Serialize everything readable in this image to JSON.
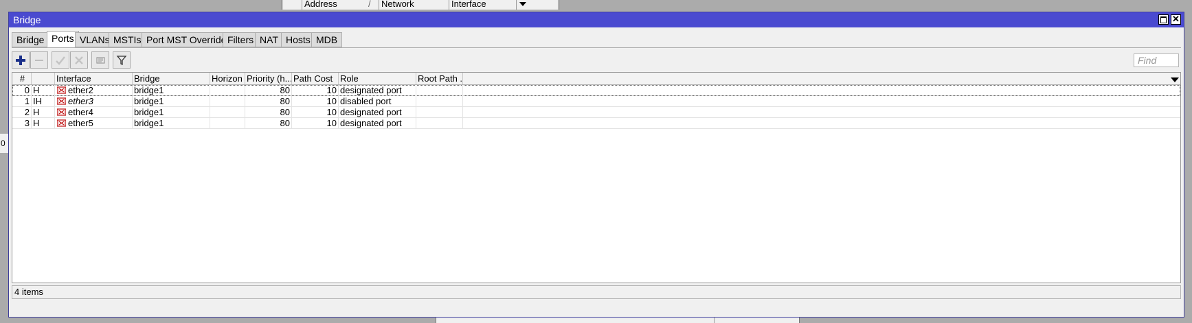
{
  "background_window": {
    "columns": [
      "Address",
      "Network",
      "Interface"
    ],
    "sort_mark": "/",
    "left_fragment": "0"
  },
  "window": {
    "title": "Bridge"
  },
  "tabs": [
    "Bridge",
    "Ports",
    "VLANs",
    "MSTIs",
    "Port MST Overrides",
    "Filters",
    "NAT",
    "Hosts",
    "MDB"
  ],
  "active_tab": "Ports",
  "toolbar": {
    "find_placeholder": "Find",
    "find_value": ""
  },
  "table": {
    "columns": [
      "#",
      "",
      "Interface",
      "Bridge",
      "Horizon",
      "Priority (h...",
      "Path Cost",
      "Role",
      "Root Path ..."
    ],
    "rows": [
      {
        "num": "0",
        "flags": "H",
        "interface": "ether2",
        "bridge": "bridge1",
        "horizon": "",
        "priority": "80",
        "path_cost": "10",
        "role": "designated port",
        "root_path": ""
      },
      {
        "num": "1",
        "flags": "IH",
        "interface": "ether3",
        "bridge": "bridge1",
        "horizon": "",
        "priority": "80",
        "path_cost": "10",
        "role": "disabled port",
        "root_path": ""
      },
      {
        "num": "2",
        "flags": "H",
        "interface": "ether4",
        "bridge": "bridge1",
        "horizon": "",
        "priority": "80",
        "path_cost": "10",
        "role": "designated port",
        "root_path": ""
      },
      {
        "num": "3",
        "flags": "H",
        "interface": "ether5",
        "bridge": "bridge1",
        "horizon": "",
        "priority": "80",
        "path_cost": "10",
        "role": "designated port",
        "root_path": ""
      }
    ]
  },
  "status": {
    "items_text": "4 items"
  },
  "colors": {
    "titlebar": "#4a4ad0",
    "add_icon": "#1a2f8a",
    "interface_icon": "#c01818"
  }
}
